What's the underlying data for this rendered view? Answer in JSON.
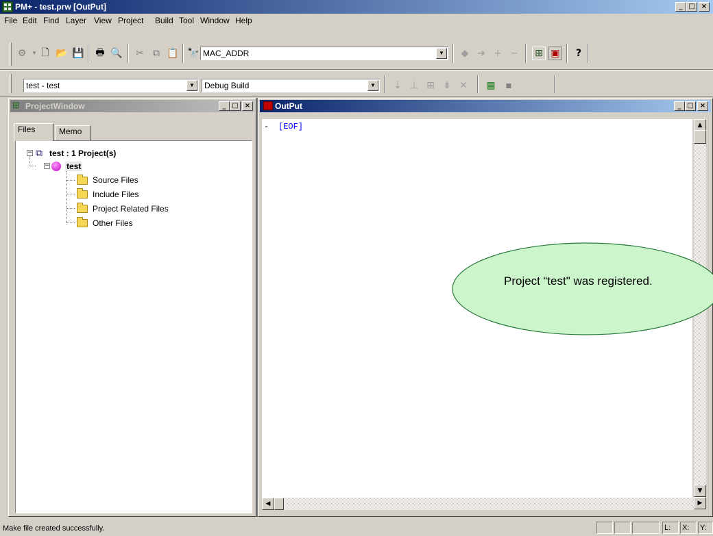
{
  "window": {
    "title": "PM+ - test.prw [OutPut]",
    "controls": {
      "minimize": "_",
      "maximize": "□",
      "close": "×"
    }
  },
  "menu": [
    "File",
    "Edit",
    "Find",
    "Layer",
    "View",
    "Project",
    "Build",
    "Tool",
    "Window",
    "Help"
  ],
  "toolbar1": {
    "search_combo_value": "MAC_ADDR",
    "icons": [
      "build-icon",
      "new-file-icon",
      "open-folder-icon",
      "save-icon",
      "print-icon",
      "print-preview-icon",
      "cut-icon",
      "copy-icon",
      "paste-icon",
      "find-icon",
      "back-arrow-icon",
      "forward-arrow-icon",
      "plus-icon",
      "minus-icon",
      "project-window-icon",
      "output-window-icon",
      "help-icon"
    ]
  },
  "toolbar2": {
    "project_combo_value": "test - test",
    "build_combo_value": "Debug Build"
  },
  "project_window": {
    "title": "ProjectWindow",
    "tabs": [
      "Files",
      "Memo"
    ],
    "active_tab": "Files",
    "tree": {
      "root": "test : 1 Project(s)",
      "project": "test",
      "folders": [
        "Source Files",
        "Include Files",
        "Project Related Files",
        "Other Files"
      ]
    }
  },
  "output_window": {
    "title": "OutPut",
    "lines": [
      {
        "marker": "-",
        "text": "[EOF]"
      }
    ],
    "text_color": "#0000ff"
  },
  "callout": {
    "text": "Project “test\" was registered.",
    "fill": "#ccf5cc",
    "border": "#2a7a3a"
  },
  "statusbar": {
    "message": "Make file created successfully.",
    "line_label": "L:",
    "x_label": "X:",
    "y_label": "Y:"
  }
}
